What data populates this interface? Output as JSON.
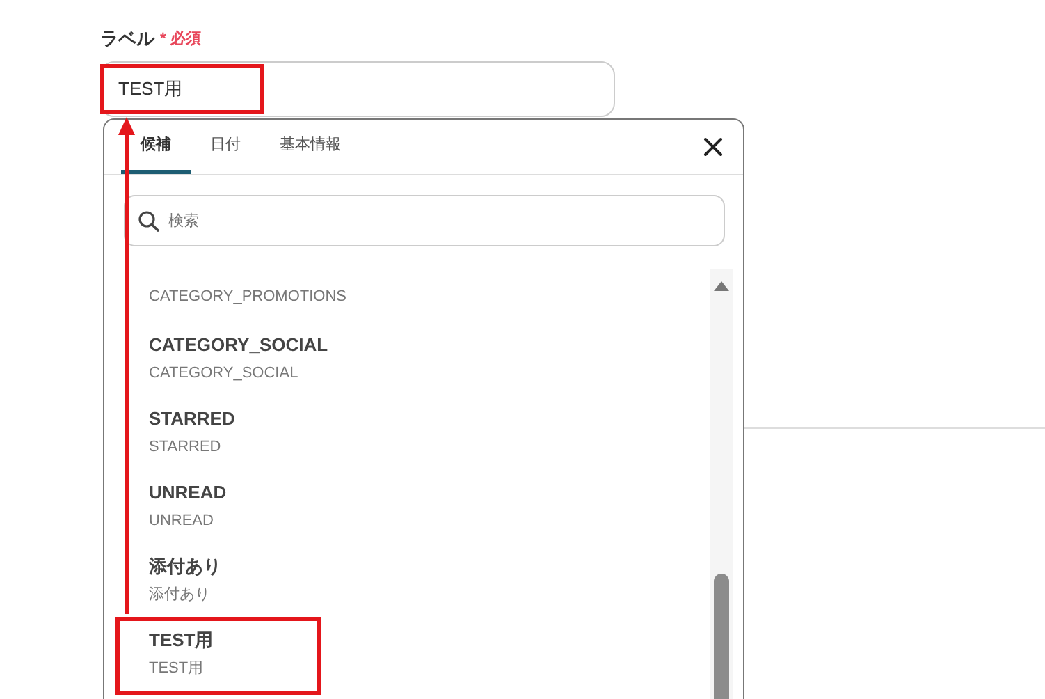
{
  "field": {
    "label": "ラベル",
    "required_mark": "*",
    "required_text": "必須",
    "value": "TEST用",
    "highlighted": true
  },
  "picker": {
    "tabs": [
      {
        "label": "候補",
        "selected": true
      },
      {
        "label": "日付",
        "selected": false
      },
      {
        "label": "基本情報",
        "selected": false
      }
    ],
    "search": {
      "placeholder": "検索"
    },
    "items": [
      {
        "subtitle": "CATEGORY_PROMOTIONS",
        "highlighted": false
      },
      {
        "title": "CATEGORY_SOCIAL",
        "subtitle": "CATEGORY_SOCIAL",
        "highlighted": false
      },
      {
        "title": "STARRED",
        "subtitle": "STARRED",
        "highlighted": false
      },
      {
        "title": "UNREAD",
        "subtitle": "UNREAD",
        "highlighted": false
      },
      {
        "title": "添付あり",
        "subtitle": "添付あり",
        "highlighted": false
      },
      {
        "title": "TEST用",
        "subtitle": "TEST用",
        "highlighted": true
      }
    ]
  },
  "annotation": {
    "arrow": true
  }
}
